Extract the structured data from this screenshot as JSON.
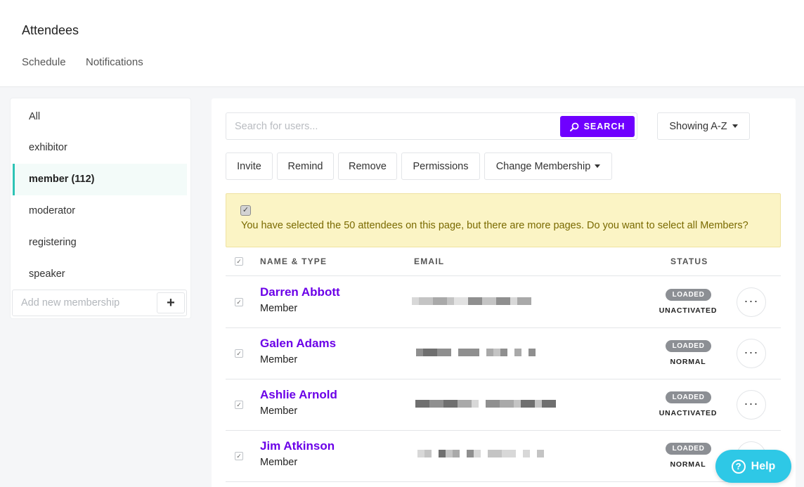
{
  "header": {
    "title": "Attendees",
    "tabs": [
      "Schedule",
      "Notifications"
    ]
  },
  "sidebar": {
    "items": [
      {
        "label": "All",
        "active": false
      },
      {
        "label": "exhibitor",
        "active": false
      },
      {
        "label": "member (112)",
        "active": true
      },
      {
        "label": "moderator",
        "active": false
      },
      {
        "label": "registering",
        "active": false
      },
      {
        "label": "speaker",
        "active": false
      }
    ],
    "add_placeholder": "Add new membership",
    "add_button": "+"
  },
  "toolbar": {
    "search_placeholder": "Search for users...",
    "search_label": "SEARCH",
    "sort_label": "Showing A-Z",
    "actions": [
      "Invite",
      "Remind",
      "Remove",
      "Permissions",
      "Change Membership"
    ]
  },
  "banner": {
    "text": "You have selected the 50 attendees on this page, but there are more pages. Do you want to select all Members?"
  },
  "table": {
    "headers": [
      "NAME & TYPE",
      "EMAIL",
      "STATUS"
    ],
    "rows": [
      {
        "name": "Darren Abbott",
        "type": "Member",
        "badge": "LOADED",
        "status": "UNACTIVATED"
      },
      {
        "name": "Galen Adams",
        "type": "Member",
        "badge": "LOADED",
        "status": "NORMAL"
      },
      {
        "name": "Ashlie Arnold",
        "type": "Member",
        "badge": "LOADED",
        "status": "UNACTIVATED"
      },
      {
        "name": "Jim Atkinson",
        "type": "Member",
        "badge": "LOADED",
        "status": "NORMAL"
      }
    ],
    "more_label": "···"
  },
  "help": {
    "label": "Help",
    "icon": "?"
  },
  "colors": {
    "accent": "#6f00ff",
    "active_border": "#2ec4b6",
    "help": "#2ec8e6",
    "banner_bg": "#fbf4c5"
  }
}
